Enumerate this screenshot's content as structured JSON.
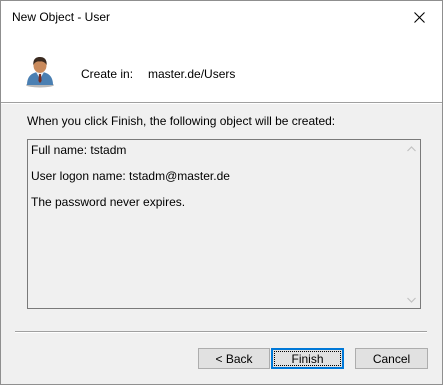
{
  "window": {
    "title": "New Object - User",
    "close_icon": "close-icon"
  },
  "header": {
    "icon": "user-icon",
    "create_in_label": "Create in:",
    "create_in_value": "master.de/Users"
  },
  "description": "When you click Finish, the following object will be created:",
  "summary": {
    "lines": [
      "Full name: tstadm",
      "User logon name: tstadm@master.de",
      "The password never expires."
    ]
  },
  "buttons": {
    "back": "< Back",
    "finish": "Finish",
    "cancel": "Cancel"
  },
  "colors": {
    "focus_border": "#0078d7",
    "dialog_background": "#f0f0f0",
    "header_background": "#ffffff"
  }
}
